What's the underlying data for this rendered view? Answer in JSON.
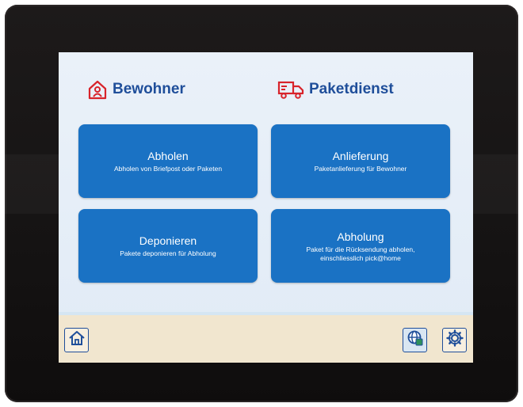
{
  "sections": {
    "residents": {
      "title": "Bewohner",
      "icon": "house-person-icon"
    },
    "parcel_service": {
      "title": "Paketdienst",
      "icon": "delivery-truck-icon"
    }
  },
  "tiles": [
    {
      "title": "Abholen",
      "subtitle": "Abholen von Briefpost oder Paketen"
    },
    {
      "title": "Anlieferung",
      "subtitle": "Paketanlieferung für Bewohner"
    },
    {
      "title": "Deponieren",
      "subtitle": "Pakete deponieren für Abholung"
    },
    {
      "title": "Abholung",
      "subtitle": "Paket für die Rücksendung abholen, einschliesslich pick@home"
    }
  ],
  "bottom_bar": {
    "home_icon": "home-icon",
    "language_icon": "globe-language-icon",
    "settings_icon": "gear-icon"
  },
  "colors": {
    "accent_blue": "#1a72c4",
    "title_blue": "#1f4e9a",
    "icon_red": "#d8232a",
    "screen_bg": "#e4edf7",
    "bottom_bar_bg": "#f1e6cf"
  }
}
